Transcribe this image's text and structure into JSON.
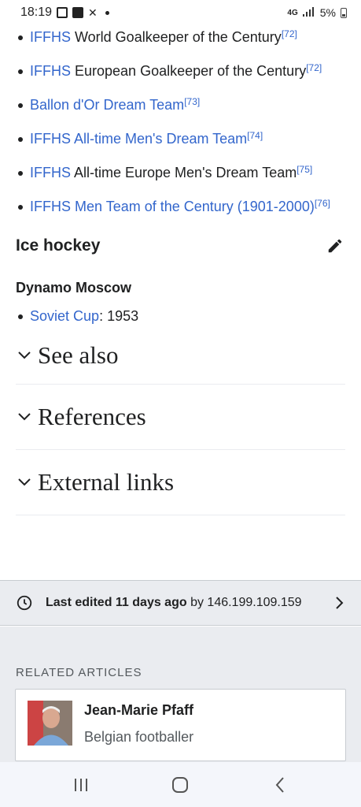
{
  "status_bar": {
    "time": "18:19",
    "network": "4G",
    "battery": "5%"
  },
  "honours": [
    {
      "link": "IFFHS",
      "rest": " World Goalkeeper of the Century",
      "ref": "[72]"
    },
    {
      "link": "IFFHS",
      "rest": " European Goalkeeper of the Century",
      "ref": "[72]"
    },
    {
      "link": "Ballon d'Or Dream Team",
      "rest": "",
      "ref": "[73]"
    },
    {
      "link": "IFFHS All-time Men's Dream Team",
      "rest": "",
      "ref": "[74]"
    },
    {
      "link": "IFFHS",
      "rest": " All-time Europe Men's Dream Team",
      "ref": "[75]"
    },
    {
      "link": "IFFHS Men Team of the Century (1901-2000)",
      "rest": "",
      "ref": "[76]"
    }
  ],
  "ice_hockey": {
    "heading": "Ice hockey",
    "club": "Dynamo Moscow",
    "item_link": "Soviet Cup",
    "item_rest": ": 1953"
  },
  "sections": [
    "See also",
    "References",
    "External links"
  ],
  "last_edited": {
    "bold": "Last edited 11 days ago",
    "rest": " by 146.199.109.159"
  },
  "related": {
    "header": "RELATED ARTICLES",
    "title": "Jean-Marie Pfaff",
    "description": "Belgian footballer"
  },
  "colors": {
    "link": "#3366cc",
    "text": "#202122",
    "footer_bg": "#eaecf0"
  }
}
